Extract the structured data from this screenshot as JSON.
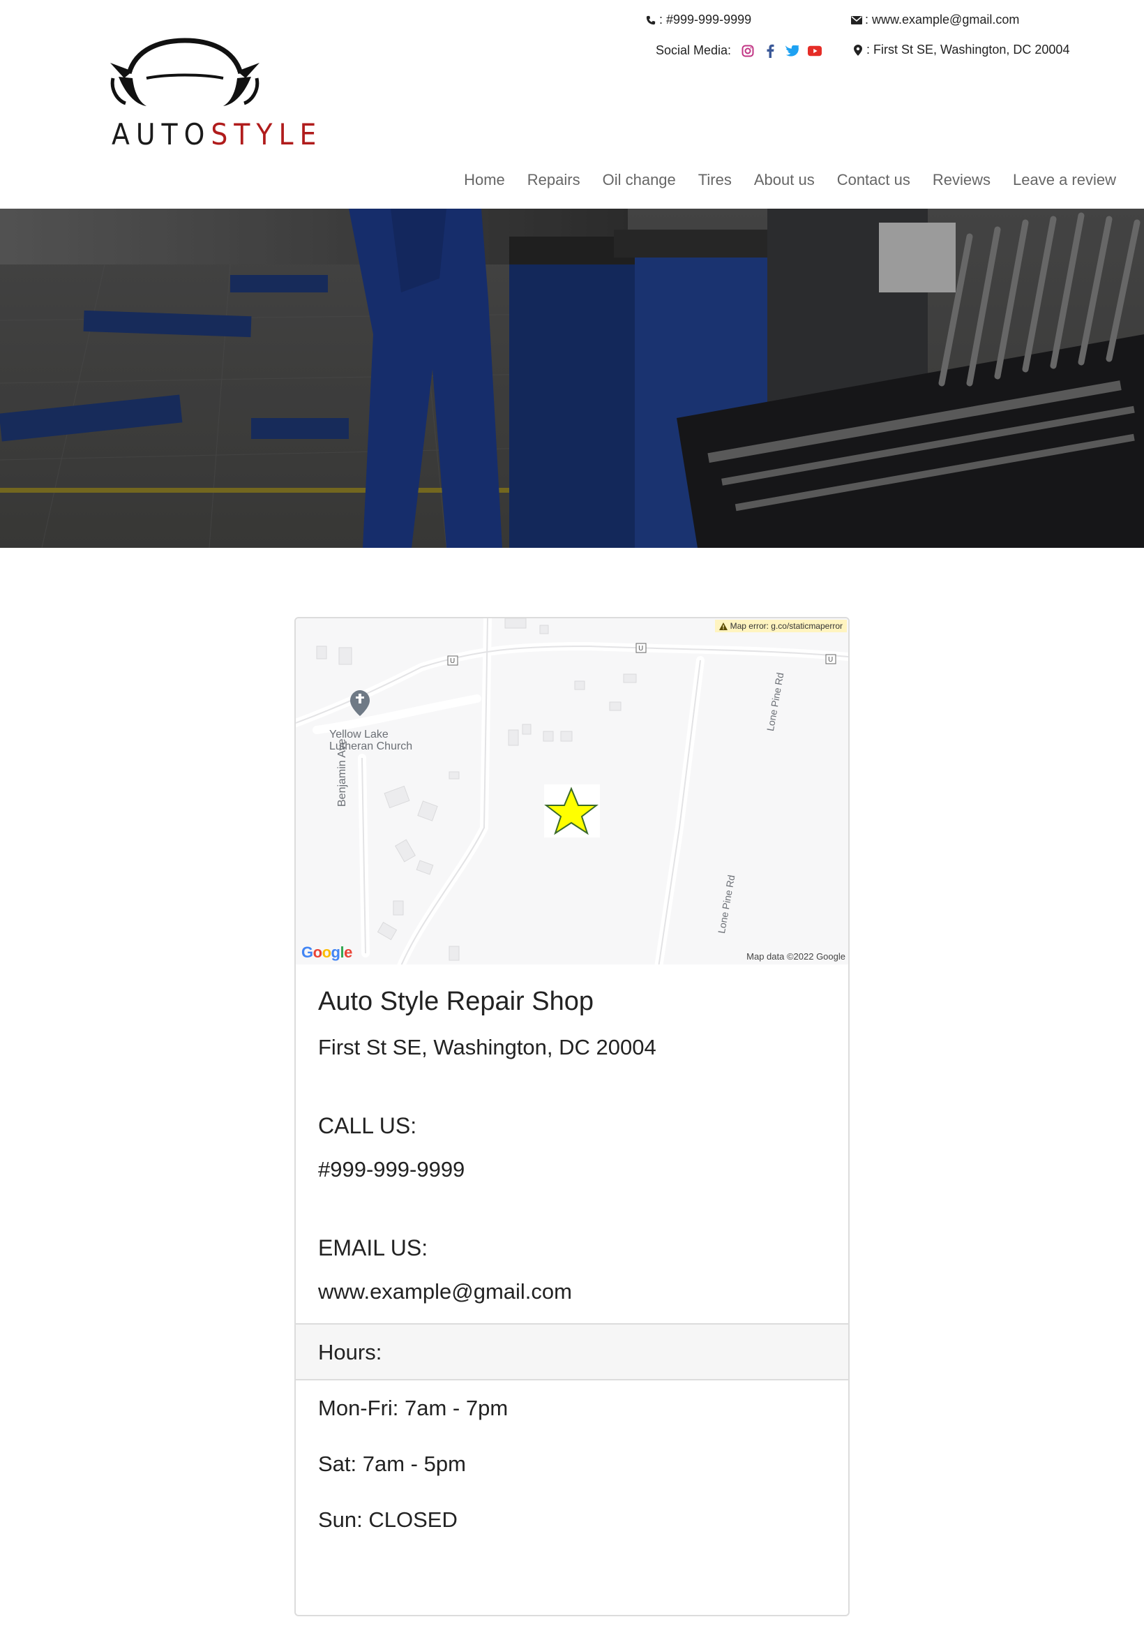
{
  "logo": {
    "word1": "AUTO",
    "word2": "STYLE"
  },
  "contact": {
    "phone": ": #999-999-9999",
    "email": ": www.example@gmail.com",
    "address": ": First St SE, Washington, DC 20004",
    "social_label": "Social Media:"
  },
  "social": [
    "instagram-icon",
    "facebook-icon",
    "twitter-icon",
    "youtube-icon"
  ],
  "colors": {
    "instagram": "#c13584",
    "facebook": "#3b5998",
    "twitter": "#1da1f2",
    "youtube": "#e52d27",
    "accent": "#b01c1c",
    "star": "#ffff00"
  },
  "nav": [
    "Home",
    "Repairs",
    "Oil change",
    "Tires",
    "About us",
    "Contact us",
    "Reviews",
    "Leave a review"
  ],
  "map": {
    "error": "Map error: g.co/staticmaperror",
    "copyright": "Map data ©2022 Google",
    "google_logo": "Google",
    "church": "Yellow Lake Lutheran Church",
    "road1": "Benjamin Ave",
    "road2": "Lone Pine Rd",
    "road3": "Lone Pine Rd"
  },
  "shop": {
    "name": "Auto Style Repair Shop",
    "address": "First St SE, Washington, DC 20004",
    "call_title": "CALL US:",
    "phone": "#999-999-9999",
    "email_title": "EMAIL US:",
    "email": "www.example@gmail.com"
  },
  "hours": {
    "title": "Hours:",
    "items": [
      "Mon-Fri: 7am - 7pm",
      "Sat: 7am - 5pm",
      "Sun: CLOSED"
    ]
  }
}
